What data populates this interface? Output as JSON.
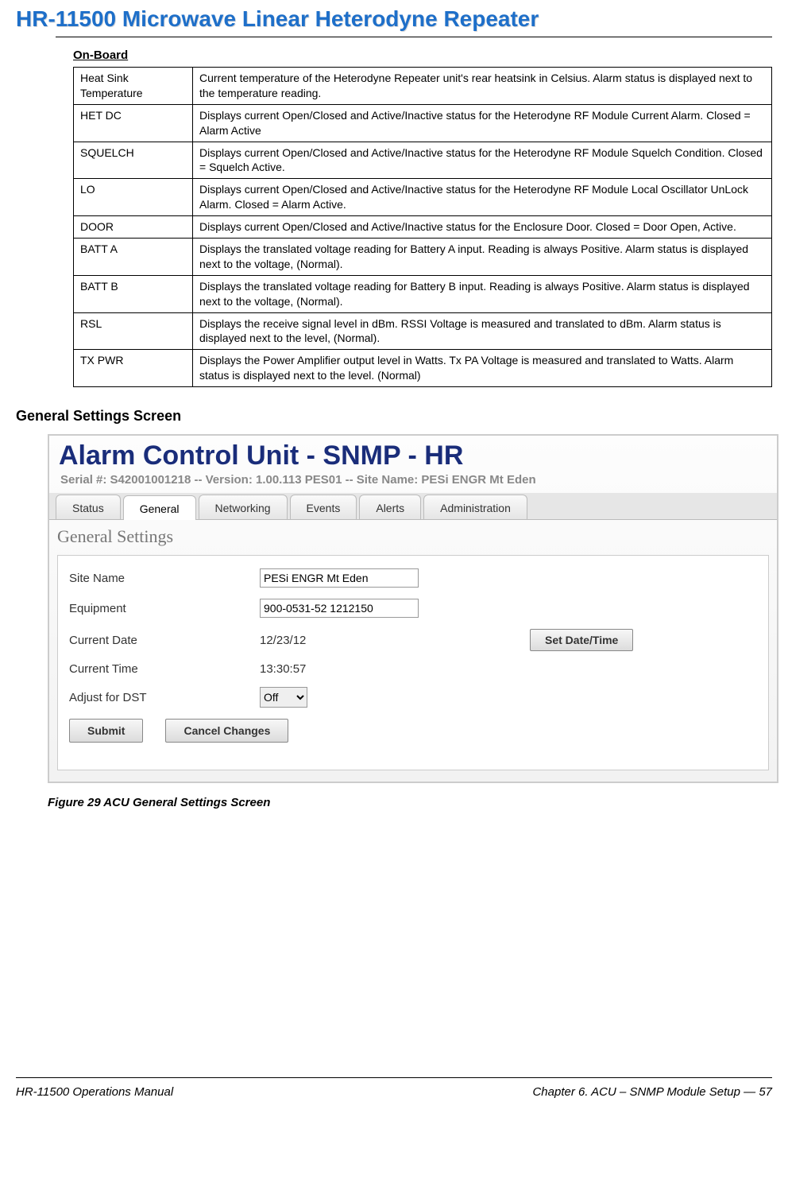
{
  "doc_title": "HR-11500 Microwave Linear Heterodyne Repeater",
  "section_label": "On-Board",
  "table": [
    {
      "k": "Heat Sink Temperature",
      "v": "Current temperature of the Heterodyne Repeater unit's rear heatsink in Celsius. Alarm status is displayed next to the temperature reading."
    },
    {
      "k": "HET DC",
      "v": "Displays current Open/Closed and Active/Inactive status for the Heterodyne RF Module Current Alarm. Closed = Alarm Active"
    },
    {
      "k": "SQUELCH",
      "v": "Displays current Open/Closed and Active/Inactive status for the Heterodyne RF Module Squelch Condition. Closed = Squelch Active."
    },
    {
      "k": "LO",
      "v": "Displays current Open/Closed and Active/Inactive status for the Heterodyne RF Module Local Oscillator UnLock Alarm. Closed = Alarm Active."
    },
    {
      "k": "DOOR",
      "v": "Displays current Open/Closed and Active/Inactive status for the Enclosure Door. Closed = Door Open, Active."
    },
    {
      "k": "BATT A",
      "v": "Displays the translated voltage reading for Battery A input. Reading is always Positive. Alarm status is displayed next to the voltage, (Normal)."
    },
    {
      "k": "BATT B",
      "v": "Displays the translated voltage reading for Battery B input. Reading is always Positive. Alarm status is displayed next to the voltage, (Normal)."
    },
    {
      "k": "RSL",
      "v": "Displays the receive signal level in dBm. RSSI Voltage is measured and translated to dBm. Alarm status is displayed next to the level, (Normal)."
    },
    {
      "k": "TX PWR",
      "v": "Displays the Power Amplifier output level in Watts. Tx PA Voltage is measured and translated to Watts. Alarm status is displayed next to the level. (Normal)"
    }
  ],
  "h2": "General Settings Screen",
  "screenshot": {
    "title": "Alarm Control Unit - SNMP - HR",
    "subtitle": "Serial #: S42001001218   --   Version: 1.00.113 PES01   --   Site Name:  PESi ENGR Mt Eden",
    "tabs": [
      "Status",
      "General",
      "Networking",
      "Events",
      "Alerts",
      "Administration"
    ],
    "active_tab": 1,
    "panel_title": "General Settings",
    "labels": {
      "site": "Site Name",
      "equip": "Equipment",
      "date": "Current Date",
      "time": "Current Time",
      "dst": "Adjust for DST"
    },
    "values": {
      "site": "PESi ENGR Mt Eden",
      "equip": "900-0531-52 1212150",
      "date": "12/23/12",
      "time": "13:30:57",
      "dst": "Off"
    },
    "buttons": {
      "set": "Set Date/Time",
      "submit": "Submit",
      "cancel": "Cancel Changes"
    }
  },
  "caption": "Figure 29  ACU General Settings Screen",
  "footer_left": "HR-11500 Operations Manual",
  "footer_right": "Chapter 6. ACU – SNMP Module Setup — 57"
}
